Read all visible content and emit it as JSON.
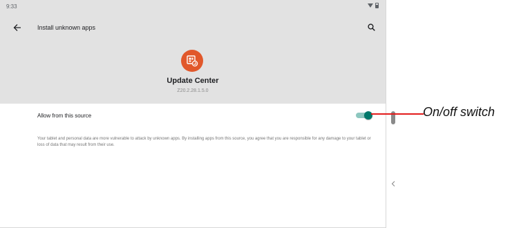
{
  "status_bar": {
    "time": "9:33",
    "icons": [
      "wifi-icon",
      "battery-icon"
    ]
  },
  "toolbar": {
    "title": "Install unknown apps",
    "back_icon": "back-arrow-icon",
    "search_icon": "search-icon"
  },
  "app": {
    "name": "Update Center",
    "version": "Z20.2.28.1.5.0",
    "icon": "update-center-app-icon",
    "icon_color": "#e1582b"
  },
  "settings": {
    "allow_label": "Allow from this source",
    "allow_enabled": true,
    "accent_color": "#00786a",
    "warning": "Your tablet and personal data are more vulnerable to attack by unknown apps. By installing apps from this source, you agree that you are responsible for any damage to your tablet or loss of data that may result from their use."
  },
  "side_panel": {
    "chevron_icon": "chevron-left-icon"
  },
  "callout": {
    "label": "On/off switch",
    "color": "#e31b1b"
  }
}
